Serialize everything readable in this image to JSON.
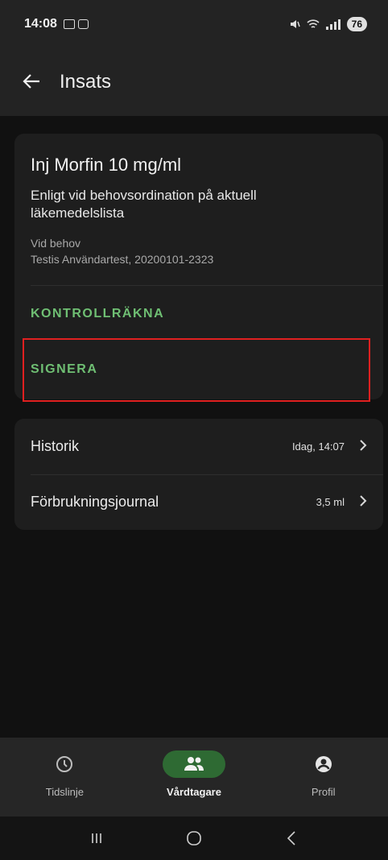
{
  "status_bar": {
    "time": "14:08",
    "battery": "76"
  },
  "app_bar": {
    "title": "Insats"
  },
  "medication": {
    "title": "Inj Morfin 10 mg/ml",
    "description": "Enligt vid behovsordination på aktuell läkemedelslista",
    "frequency": "Vid behov",
    "patient": "Testis Användartest, 20200101-2323"
  },
  "actions": {
    "kontrollrakna": "KONTROLLRÄKNA",
    "signera": "SIGNERA"
  },
  "list": [
    {
      "label": "Historik",
      "value": "Idag, 14:07"
    },
    {
      "label": "Förbrukningsjournal",
      "value": "3,5 ml"
    }
  ],
  "bottom_nav": [
    {
      "label": "Tidslinje",
      "icon": "clock-icon"
    },
    {
      "label": "Vårdtagare",
      "icon": "people-icon",
      "active": true
    },
    {
      "label": "Profil",
      "icon": "account-circle-icon"
    }
  ],
  "colors": {
    "accent_green": "#6fbf73",
    "active_pill": "#2e6a33",
    "highlight": "#e02020"
  }
}
